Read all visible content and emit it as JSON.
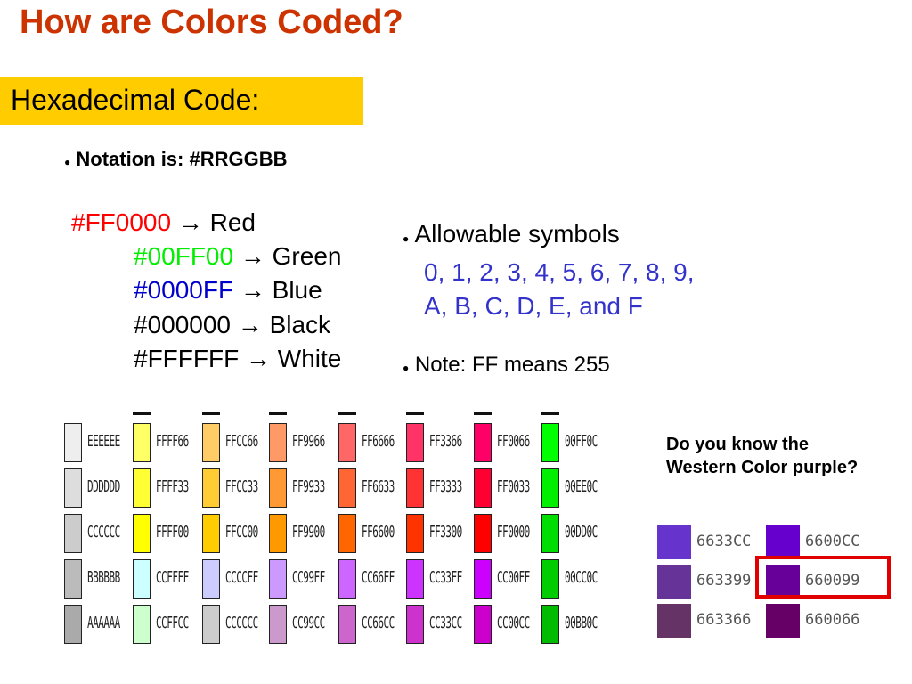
{
  "title": "How are Colors Coded?",
  "subtitle": "Hexadecimal Code:",
  "bullets": {
    "notation": "Notation is: #RRGGBB",
    "allow_label": "Allowable symbols",
    "allow_line1": "0, 1, 2, 3, 4, 5, 6, 7, 8, 9,",
    "allow_line2": "A, B, C, D, E, and F",
    "note": "Note:  FF means 255"
  },
  "arrow": "→",
  "hex_examples": [
    {
      "code": "#FF0000",
      "name": "Red",
      "color": "#ff0000"
    },
    {
      "code": "#00FF00",
      "name": "Green",
      "color": "#00ee00"
    },
    {
      "code": "#0000FF",
      "name": "Blue",
      "color": "#0000cc"
    },
    {
      "code": "#000000",
      "name": "Black",
      "color": "#000000"
    },
    {
      "code": "#FFFFFF",
      "name": "White",
      "color": "#000000"
    }
  ],
  "swatch_columns": [
    {
      "colors": [
        "#EEEEEE",
        "#DDDDDD",
        "#CCCCCC",
        "#BBBBBB",
        "#AAAAAA"
      ],
      "labels": [
        "EEEEEE",
        "DDDDDD",
        "CCCCCC",
        "BBBBBB",
        "AAAAAA"
      ]
    },
    {
      "colors": [
        "#FFFF66",
        "#FFFF33",
        "#FFFF00",
        "#CCFFFF",
        "#CCFFCC"
      ],
      "labels": [
        "FFFF66",
        "FFFF33",
        "FFFF00",
        "CCFFFF",
        "CCFFCC"
      ]
    },
    {
      "colors": [
        "#FFCC66",
        "#FFCC33",
        "#FFCC00",
        "#CCCCFF",
        "#CCCCCC"
      ],
      "labels": [
        "FFCC66",
        "FFCC33",
        "FFCC00",
        "CCCCFF",
        "CCCCCC"
      ]
    },
    {
      "colors": [
        "#FF9966",
        "#FF9933",
        "#FF9900",
        "#CC99FF",
        "#CC99CC"
      ],
      "labels": [
        "FF9966",
        "FF9933",
        "FF9900",
        "CC99FF",
        "CC99CC"
      ]
    },
    {
      "colors": [
        "#FF6666",
        "#FF6633",
        "#FF6600",
        "#CC66FF",
        "#CC66CC"
      ],
      "labels": [
        "FF6666",
        "FF6633",
        "FF6600",
        "CC66FF",
        "CC66CC"
      ]
    },
    {
      "colors": [
        "#FF3366",
        "#FF3333",
        "#FF3300",
        "#CC33FF",
        "#CC33CC"
      ],
      "labels": [
        "FF3366",
        "FF3333",
        "FF3300",
        "CC33FF",
        "CC33CC"
      ]
    },
    {
      "colors": [
        "#FF0066",
        "#FF0033",
        "#FF0000",
        "#CC00FF",
        "#CC00CC"
      ],
      "labels": [
        "FF0066",
        "FF0033",
        "FF0000",
        "CC00FF",
        "CC00CC"
      ]
    },
    {
      "colors": [
        "#00FF00",
        "#00EE00",
        "#00DD00",
        "#00CC00",
        "#00BB00"
      ],
      "labels": [
        "00FF0C",
        "00EE0C",
        "00DD0C",
        "00CC0C",
        "00BB0C"
      ]
    }
  ],
  "question": "Do you know the Western Color purple?",
  "purple_swatches": [
    {
      "color": "#6633CC",
      "label": "6633CC"
    },
    {
      "color": "#6600CC",
      "label": "6600CC"
    },
    {
      "color": "#663399",
      "label": "663399"
    },
    {
      "color": "#660099",
      "label": "660099"
    },
    {
      "color": "#663366",
      "label": "663366"
    },
    {
      "color": "#660066",
      "label": "660066"
    }
  ],
  "highlight_color": "#e00000"
}
